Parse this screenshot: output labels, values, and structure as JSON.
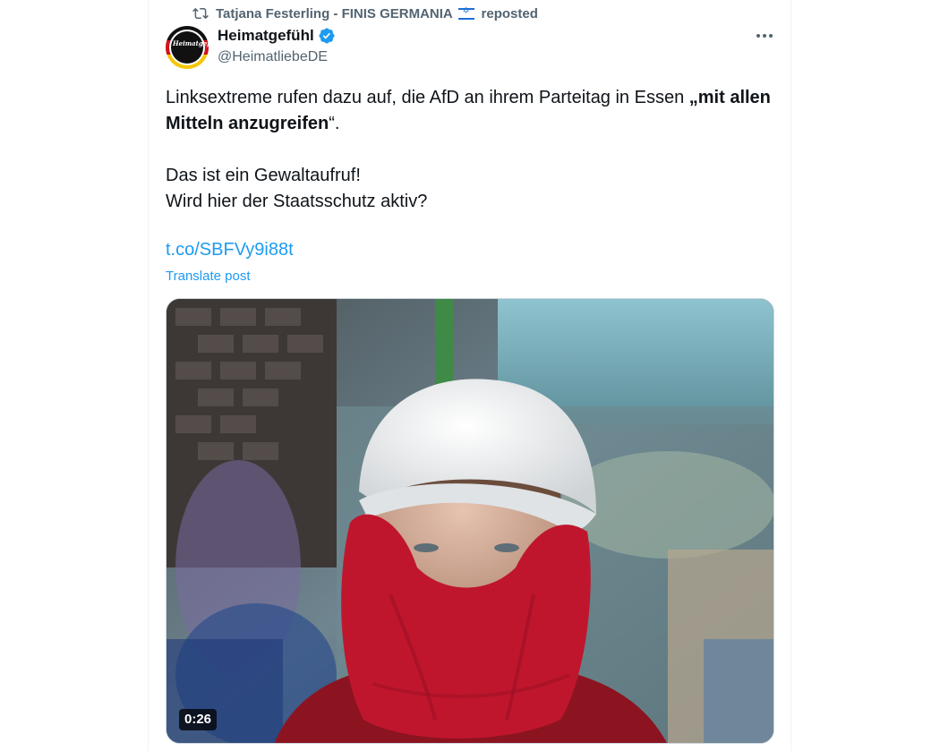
{
  "repost": {
    "icon": "repost-icon",
    "reposter_name": "Tatjana Festerling - FINIS GERMANIA",
    "flag": "israel-flag-emoji",
    "suffix": "reposted"
  },
  "author": {
    "name": "Heimatgefühl",
    "handle": "@HeimatliebeDE",
    "avatar_text": "Heimatgefühl",
    "verified_color": "#1d9bf0"
  },
  "post": {
    "line1_plain": "Linksextreme rufen dazu auf, die AfD an ihrem Parteitag in Essen ",
    "line1_bold": "„mit allen Mitteln anzugreifen",
    "line1_end": "“.",
    "line2": "Das ist ein Gewaltaufruf!",
    "line3": "Wird hier der Staatsschutz aktiv?",
    "link": "t.co/SBFVy9i88t",
    "translate_label": "Translate post"
  },
  "media": {
    "type": "video",
    "duration": "0:26"
  },
  "colors": {
    "accent": "#1d9bf0",
    "secondary_text": "#536471",
    "primary_text": "#0f1419"
  }
}
